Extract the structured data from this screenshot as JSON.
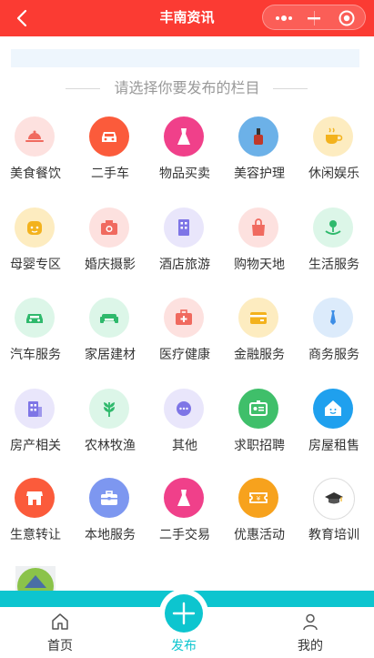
{
  "header": {
    "title": "丰南资讯"
  },
  "section": {
    "title": "请选择你要发布的栏目"
  },
  "categories": [
    {
      "label": "美食餐饮",
      "icon": "food-cloche-icon",
      "bg": "#fde1df",
      "fg": "#f06a5f"
    },
    {
      "label": "二手车",
      "icon": "car-icon",
      "bg": "#fb5b3b",
      "fg": "#ffffff"
    },
    {
      "label": "物品买卖",
      "icon": "dress-icon",
      "bg": "#f0408a",
      "fg": "#ffffff"
    },
    {
      "label": "美容护理",
      "icon": "nail-polish-icon",
      "bg": "#6cb1e8",
      "fg": "#c0392b"
    },
    {
      "label": "休闲娱乐",
      "icon": "tea-cup-icon",
      "bg": "#fdecc0",
      "fg": "#f3b21d"
    },
    {
      "label": "母婴专区",
      "icon": "baby-icon",
      "bg": "#fdecc0",
      "fg": "#f3b21d"
    },
    {
      "label": "婚庆摄影",
      "icon": "camera-icon",
      "bg": "#fde1df",
      "fg": "#f06a5f"
    },
    {
      "label": "酒店旅游",
      "icon": "hotel-icon",
      "bg": "#e9e6fb",
      "fg": "#7e75e6"
    },
    {
      "label": "购物天地",
      "icon": "shopping-bag-icon",
      "bg": "#fde1df",
      "fg": "#f06a5f"
    },
    {
      "label": "生活服务",
      "icon": "plant-hand-icon",
      "bg": "#dcf6e8",
      "fg": "#2fb96c"
    },
    {
      "label": "汽车服务",
      "icon": "car-service-icon",
      "bg": "#dcf6e8",
      "fg": "#2fb96c"
    },
    {
      "label": "家居建材",
      "icon": "sofa-icon",
      "bg": "#dcf6e8",
      "fg": "#2fb96c"
    },
    {
      "label": "医疗健康",
      "icon": "medical-kit-icon",
      "bg": "#fde1df",
      "fg": "#f06a5f"
    },
    {
      "label": "金融服务",
      "icon": "credit-card-icon",
      "bg": "#fdecc0",
      "fg": "#f3b21d"
    },
    {
      "label": "商务服务",
      "icon": "tie-icon",
      "bg": "#dcebfb",
      "fg": "#3d8ee6"
    },
    {
      "label": "房产相关",
      "icon": "building-icon",
      "bg": "#e9e6fb",
      "fg": "#7e75e6"
    },
    {
      "label": "农林牧渔",
      "icon": "leaf-icon",
      "bg": "#dcf6e8",
      "fg": "#2fb96c"
    },
    {
      "label": "其他",
      "icon": "chat-dots-icon",
      "bg": "#e9e6fb",
      "fg": "#7e75e6"
    },
    {
      "label": "求职招聘",
      "icon": "id-card-icon",
      "bg": "#3fbf6a",
      "fg": "#ffffff"
    },
    {
      "label": "房屋租售",
      "icon": "house-smile-icon",
      "bg": "#1fa0ee",
      "fg": "#ffffff"
    },
    {
      "label": "生意转让",
      "icon": "shop-icon",
      "bg": "#fb5b3b",
      "fg": "#ffffff"
    },
    {
      "label": "本地服务",
      "icon": "toolbox-icon",
      "bg": "#7d97f0",
      "fg": "#ffffff"
    },
    {
      "label": "二手交易",
      "icon": "dress-icon",
      "bg": "#f0408a",
      "fg": "#ffffff"
    },
    {
      "label": "优惠活动",
      "icon": "coupon-icon",
      "bg": "#f7a21d",
      "fg": "#ffffff"
    },
    {
      "label": "教育培训",
      "icon": "graduation-cap-icon",
      "bg": "#ffffff",
      "fg": "#333333"
    }
  ],
  "tabs": [
    {
      "label": "首页",
      "icon": "home-icon",
      "color": "#333333"
    },
    {
      "label": "发布",
      "icon": "plus-icon",
      "color": "#0dc5cf"
    },
    {
      "label": "我的",
      "icon": "user-icon",
      "color": "#333333"
    }
  ],
  "colors": {
    "header": "#fb3b33",
    "accent": "#0dc5cf"
  }
}
